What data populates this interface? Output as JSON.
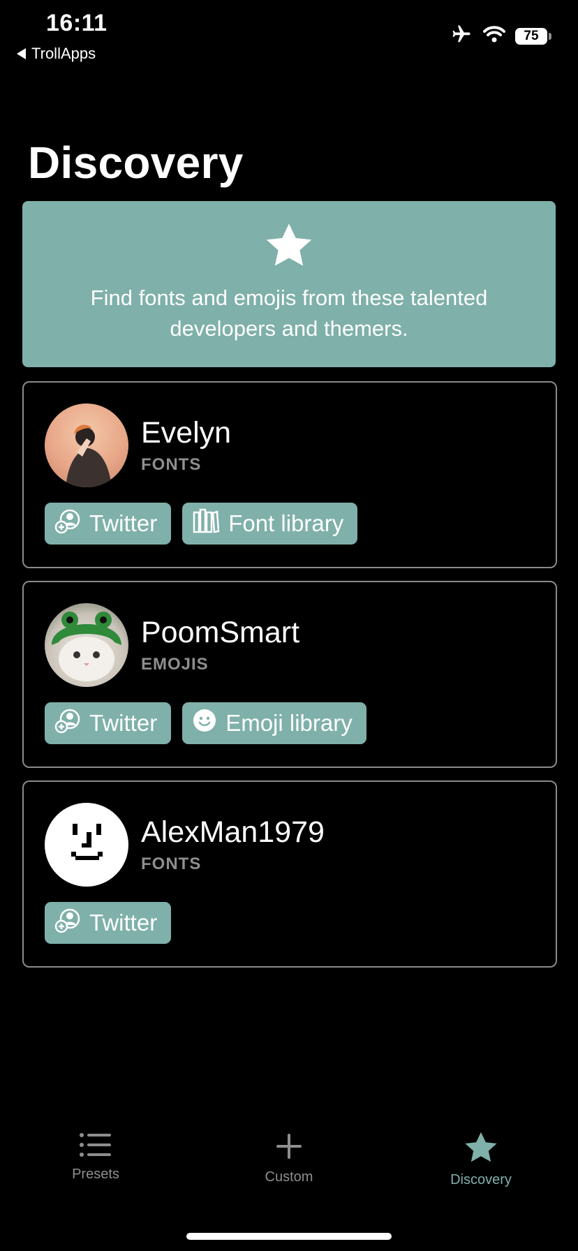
{
  "status_bar": {
    "time": "16:11",
    "back_app": "TrollApps",
    "battery": "75",
    "icons": [
      "airplane-icon",
      "wifi-icon",
      "battery-icon"
    ]
  },
  "header": {
    "title": "Discovery"
  },
  "banner": {
    "icon": "star-icon",
    "text": "Find fonts and emojis from these talented developers and themers."
  },
  "creators": [
    {
      "name": "Evelyn",
      "role": "FONTS",
      "buttons": [
        {
          "label": "Twitter",
          "icon": "user-add-icon"
        },
        {
          "label": "Font library",
          "icon": "books-icon"
        }
      ]
    },
    {
      "name": "PoomSmart",
      "role": "EMOJIS",
      "buttons": [
        {
          "label": "Twitter",
          "icon": "user-add-icon"
        },
        {
          "label": "Emoji library",
          "icon": "smiley-icon"
        }
      ]
    },
    {
      "name": "AlexMan1979",
      "role": "FONTS",
      "buttons": [
        {
          "label": "Twitter",
          "icon": "user-add-icon"
        }
      ]
    }
  ],
  "tabbar": {
    "tabs": [
      {
        "label": "Presets",
        "icon": "list-icon"
      },
      {
        "label": "Custom",
        "icon": "plus-icon"
      },
      {
        "label": "Discovery",
        "icon": "star-icon",
        "selected": true
      }
    ]
  },
  "colors": {
    "accent": "#7fb0aa",
    "background": "#000000",
    "secondary_text": "#8e8e8e"
  }
}
